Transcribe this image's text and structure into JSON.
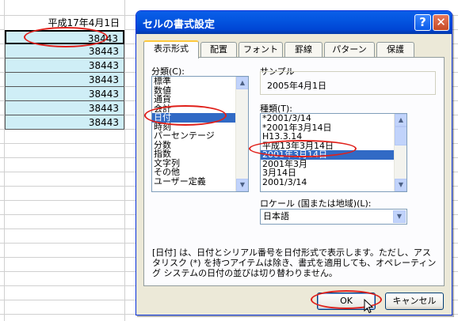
{
  "sheet": {
    "header_cell": "平成17年4月1日",
    "values": [
      "38443",
      "38443",
      "38443",
      "38443",
      "38443",
      "38443",
      "38443"
    ]
  },
  "dialog": {
    "title": "セルの書式設定",
    "help_label": "?",
    "close_label": "✕",
    "tabs": [
      "表示形式",
      "配置",
      "フォント",
      "罫線",
      "パターン",
      "保護"
    ],
    "category_label": "分類(C):",
    "categories": [
      "標準",
      "数値",
      "通貨",
      "会計",
      "日付",
      "時刻",
      "パーセンテージ",
      "分数",
      "指数",
      "文字列",
      "その他",
      "ユーザー定義"
    ],
    "selected_category": "日付",
    "sample_label": "サンプル",
    "sample_value": "2005年4月1日",
    "type_label": "種類(T):",
    "types": [
      "*2001/3/14",
      "*2001年3月14日",
      "H13.3.14",
      "平成13年3月14日",
      "2001年3月14日",
      "2001年3月",
      "3月14日",
      "2001/3/14"
    ],
    "selected_type": "2001年3月14日",
    "locale_label": "ロケール (国または地域)(L):",
    "locale_value": "日本語",
    "description": "[日付] は、日付とシリアル番号を日付形式で表示します。ただし、アスタリスク (*) を持つアイテムは除き、書式を適用しても、オペレーティング システムの日付の並びは切り替わりません。",
    "ok_label": "OK",
    "cancel_label": "キャンセル"
  },
  "colors": {
    "title_bar": "#0046d5",
    "selection": "#316ac5",
    "highlight_ring": "#e0201a",
    "cell_fill": "#cfeef6"
  }
}
